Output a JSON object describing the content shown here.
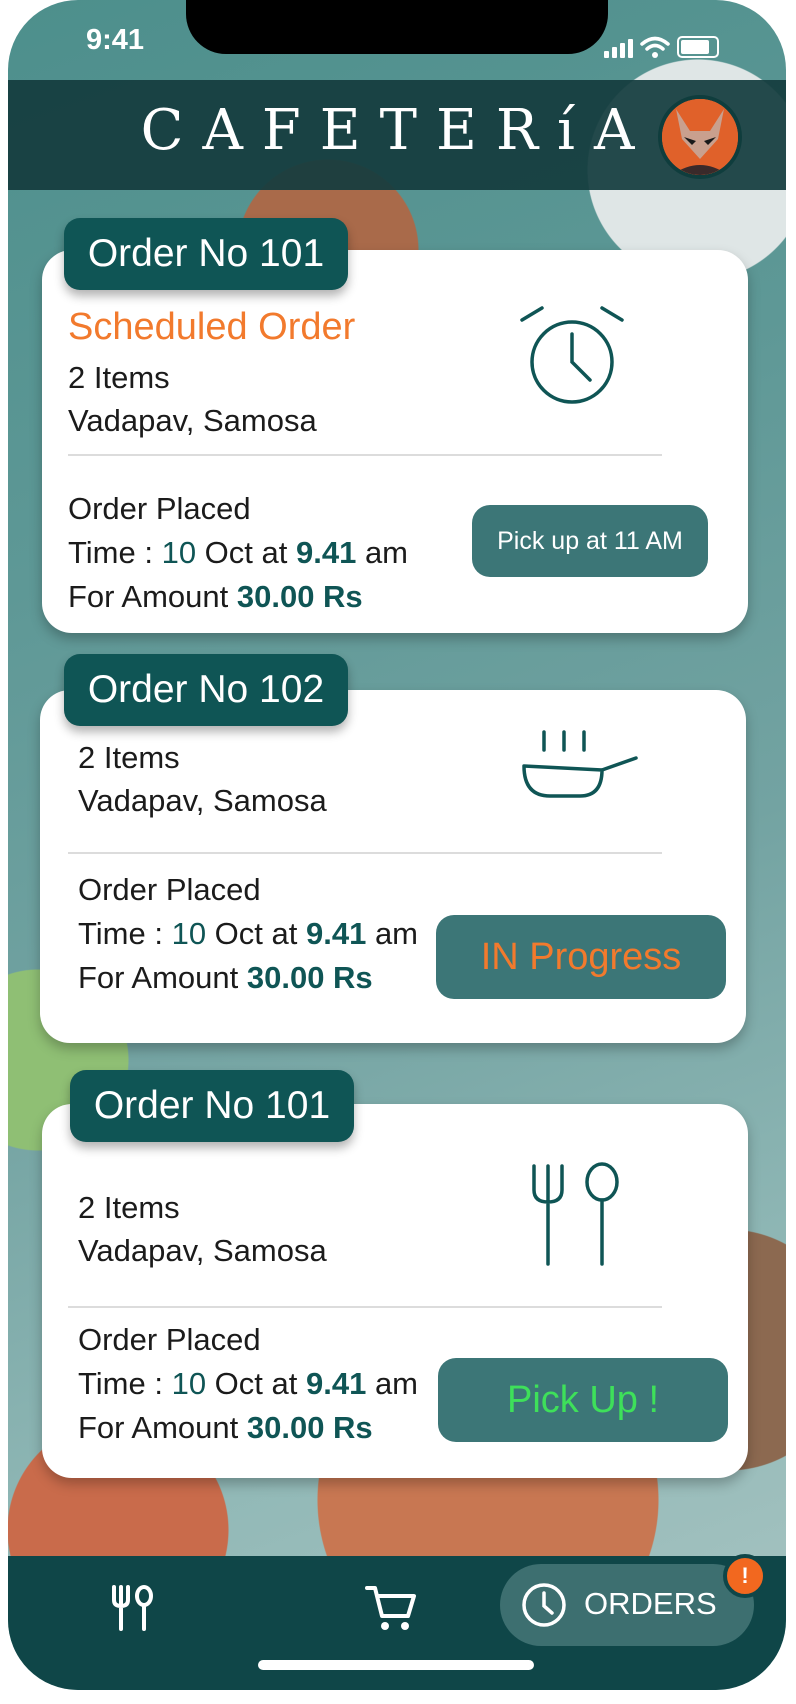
{
  "status": {
    "time": "9:41"
  },
  "header": {
    "title": "CAFETERíA"
  },
  "orders": [
    {
      "tag": "Order No 101",
      "status_label": "Scheduled Order",
      "items_count": "2 Items",
      "items": "Vadapav, Samosa",
      "placed_label": "Order Placed",
      "time_prefix": "Time : ",
      "time_day": "10",
      "time_mid": " Oct at ",
      "time_value": "9.41",
      "time_suffix": " am",
      "amount_prefix": "For Amount ",
      "amount_value": "30.00 Rs",
      "action_label": "Pick up at 11 AM",
      "icon": "alarm-clock-icon"
    },
    {
      "tag": "Order No 102",
      "items_count": "2 Items",
      "items": "Vadapav, Samosa",
      "placed_label": "Order Placed",
      "time_prefix": "Time : ",
      "time_day": "10",
      "time_mid": " Oct at ",
      "time_value": "9.41",
      "time_suffix": " am",
      "amount_prefix": "For Amount ",
      "amount_value": "30.00 Rs",
      "action_label": "IN Progress",
      "icon": "frying-pan-icon"
    },
    {
      "tag": "Order No 101",
      "items_count": "2 Items",
      "items": "Vadapav, Samosa",
      "placed_label": "Order Placed",
      "time_prefix": "Time : ",
      "time_day": "10",
      "time_mid": " Oct at ",
      "time_value": "9.41",
      "time_suffix": " am",
      "amount_prefix": "For Amount ",
      "amount_value": "30.00 Rs",
      "action_label": "Pick Up !",
      "icon": "fork-spoon-icon"
    }
  ],
  "nav": {
    "orders_label": "ORDERS",
    "badge": "!",
    "items": [
      "fork-spoon-icon",
      "cart-icon",
      "clock-icon"
    ]
  },
  "colors": {
    "primary": "#0f5555",
    "accent_orange": "#f27a2d",
    "pickup_green": "#3ee05a",
    "button": "#3c7677"
  }
}
